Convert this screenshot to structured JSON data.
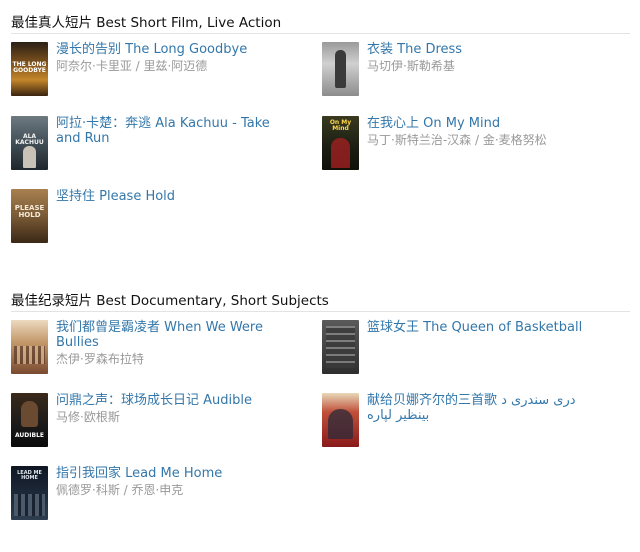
{
  "sections": [
    {
      "title": "最佳真人短片 Best Short Film, Live Action",
      "items": [
        {
          "title": "漫长的告别 The Long Goodbye",
          "people": "阿奈尔·卡里亚 / 里兹·阿迈德",
          "poster_text": "THE LONG GOODBYE",
          "poster_color": "#b27a2a"
        },
        {
          "title": "衣装 The Dress",
          "people": "马切伊·斯勒希基",
          "poster_text": "",
          "poster_color": "#6a6a6a"
        },
        {
          "title": "阿拉·卡楚：奔逃 Ala Kachuu - Take and Run",
          "people": "",
          "poster_text": "ALA KACHUU",
          "poster_color": "#3e4a52"
        },
        {
          "title": "在我心上 On My Mind",
          "people": "马丁·斯特兰治-汉森 / 金·麦格努松",
          "poster_text": "On My Mind",
          "poster_color": "#2a2e1a"
        },
        {
          "title": "坚持住 Please Hold",
          "people": "",
          "poster_text": "PLEASE HOLD",
          "poster_color": "#7a5a36"
        }
      ]
    },
    {
      "title": "最佳纪录短片 Best Documentary, Short Subjects",
      "items": [
        {
          "title": "我们都曾是霸凌者 When We Were Bullies",
          "people": "杰伊·罗森布拉特",
          "poster_text": "",
          "poster_color": "#c49a6c"
        },
        {
          "title": "篮球女王 The Queen of Basketball",
          "people": "",
          "poster_text": "",
          "poster_color": "#4a4a4a"
        },
        {
          "title": "问鼎之声：球场成长日记 Audible",
          "people": "马修·欧根斯",
          "poster_text": "AUDIBLE",
          "poster_color": "#1a1a1a"
        },
        {
          "title": "献给贝娜齐尔的三首歌 درى سندرى د بينظير لپاره",
          "people": "",
          "poster_text": "",
          "poster_color": "#b03a2a"
        },
        {
          "title": "指引我回家 Lead Me Home",
          "people": "佩德罗·科斯 / 乔恩·申克",
          "poster_text": "LEAD ME HOME",
          "poster_color": "#1e2a3a"
        }
      ]
    }
  ]
}
